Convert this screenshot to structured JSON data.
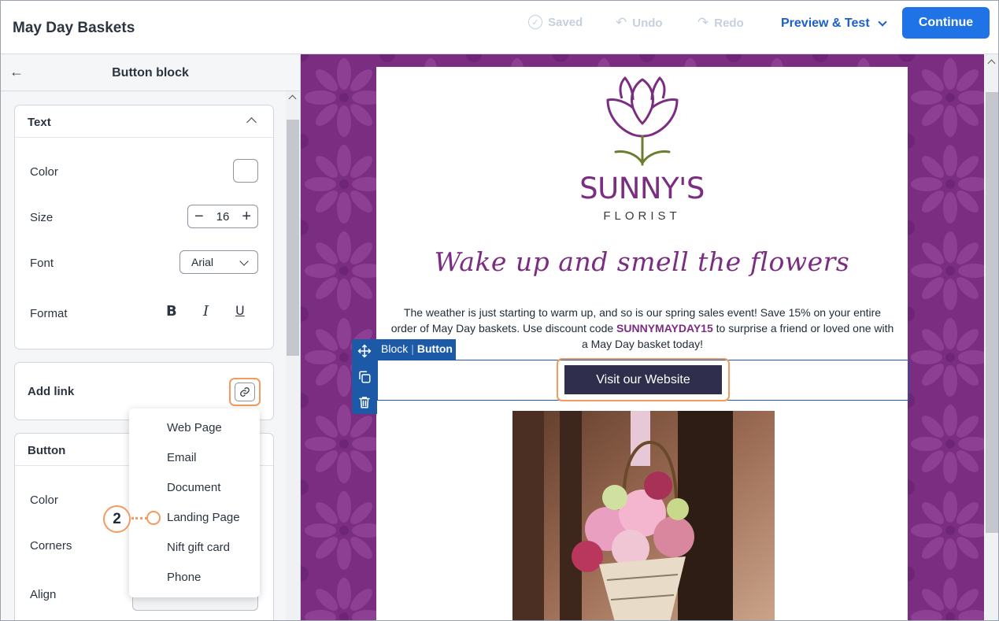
{
  "header": {
    "title": "May Day Baskets",
    "saved_label": "Saved",
    "undo_label": "Undo",
    "redo_label": "Redo",
    "preview_label": "Preview & Test",
    "continue_label": "Continue"
  },
  "panel": {
    "title": "Button block",
    "text_section": {
      "heading": "Text",
      "color_label": "Color",
      "color_value": "#ffffff",
      "size_label": "Size",
      "size_value": "16",
      "font_label": "Font",
      "font_value": "Arial",
      "format_label": "Format",
      "bold_glyph": "B",
      "italic_glyph": "I",
      "underline_glyph": "U"
    },
    "link_section": {
      "label": "Add link"
    },
    "button_section": {
      "heading": "Button",
      "color_label": "Color",
      "corners_label": "Corners",
      "align_label": "Align"
    }
  },
  "link_menu": {
    "items": [
      "Web Page",
      "Email",
      "Document",
      "Landing Page",
      "Nift gift card",
      "Phone"
    ]
  },
  "callout": {
    "number": "2"
  },
  "email": {
    "brand_name": "SUNNY'S",
    "brand_sub": "FLORIST",
    "headline": "Wake up and smell the flowers",
    "body_part1": "The weather is just starting to warm up, and so is our spring sales event! Save 15% on your entire order of May Day baskets. Use discount code ",
    "discount_code": "SUNNYMAYDAY15",
    "body_part2": " to surprise a friend or loved one with a May Day basket today!",
    "button_label": "Visit our Website",
    "brand_color": "#7b2d82",
    "button_color": "#2f2e4d"
  },
  "block_toolbar": {
    "crumb_parent": "Block",
    "crumb_separator": "|",
    "crumb_current": "Button"
  },
  "icons": {
    "back": "arrow-left-icon",
    "link": "link-icon",
    "move": "move-icon",
    "duplicate": "duplicate-icon",
    "delete": "trash-icon"
  },
  "colors": {
    "accent": "#1f73e6",
    "highlight": "#f39b5e",
    "selection": "#1c5aa8"
  }
}
